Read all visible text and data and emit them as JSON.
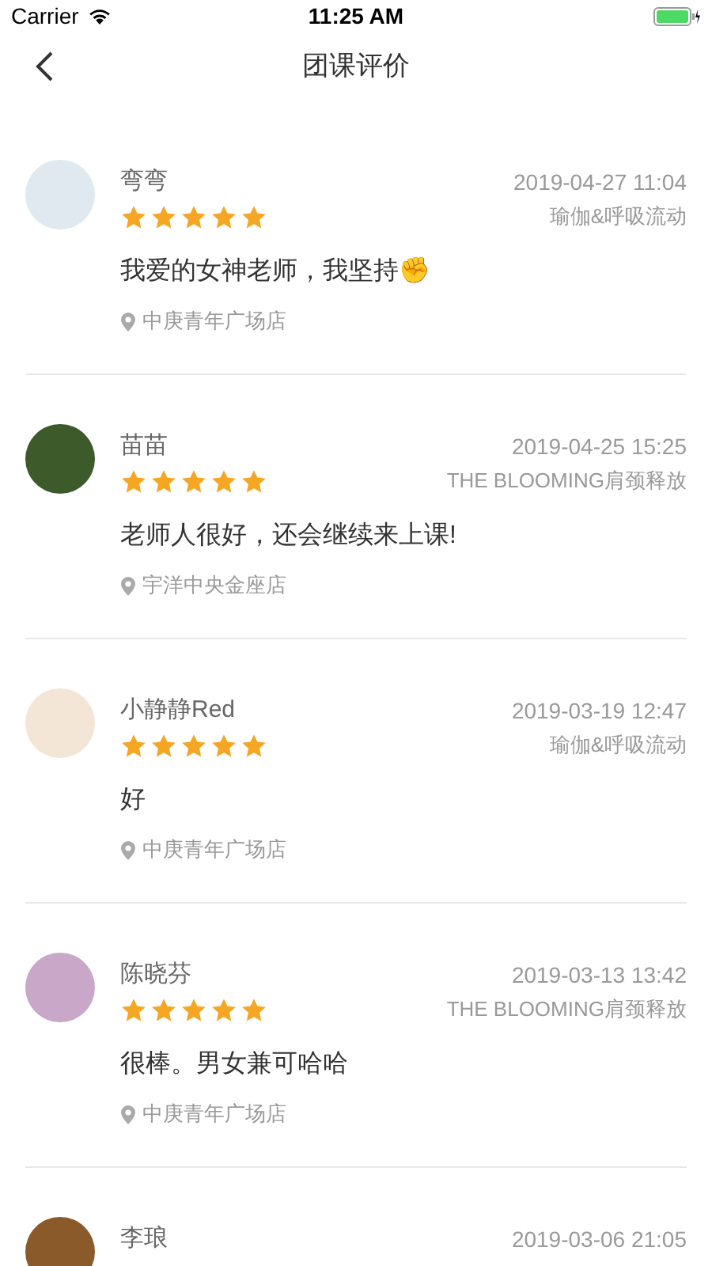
{
  "status_bar": {
    "carrier": "Carrier",
    "time": "11:25 AM"
  },
  "nav": {
    "title": "团课评价"
  },
  "reviews": [
    {
      "name": "弯弯",
      "date": "2019-04-27 11:04",
      "course": "瑜伽&呼吸流动",
      "stars": 5,
      "text": "我爱的女神老师，我坚持✊",
      "location": "中庚青年广场店"
    },
    {
      "name": "苗苗",
      "date": "2019-04-25 15:25",
      "course": "THE BLOOMING肩颈释放",
      "stars": 5,
      "text": "老师人很好，还会继续来上课!",
      "location": "宇洋中央金座店"
    },
    {
      "name": "小静静Red",
      "date": "2019-03-19 12:47",
      "course": "瑜伽&呼吸流动",
      "stars": 5,
      "text": "好",
      "location": "中庚青年广场店"
    },
    {
      "name": "陈晓芬",
      "date": "2019-03-13 13:42",
      "course": "THE BLOOMING肩颈释放",
      "stars": 5,
      "text": "很棒。男女兼可哈哈",
      "location": "中庚青年广场店"
    },
    {
      "name": "李琅",
      "date": "2019-03-06 21:05"
    }
  ]
}
